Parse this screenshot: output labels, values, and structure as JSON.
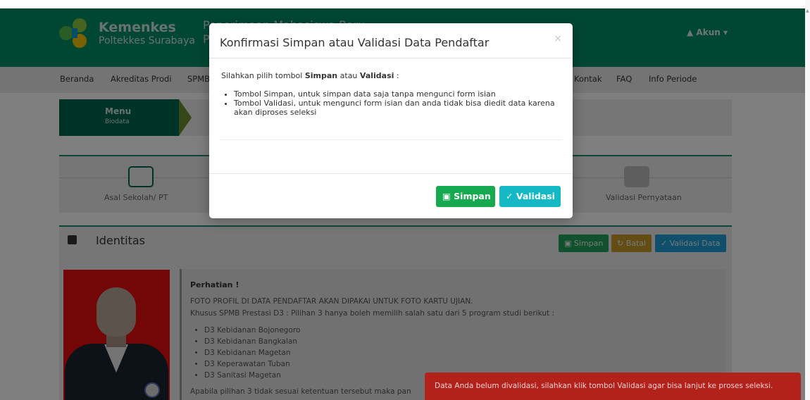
{
  "top_cut_text": "",
  "header": {
    "brand_title": "Kemenkes",
    "brand_subtitle": "Poltekkes Surabaya",
    "subtitle_line1": "Penerimaan Mahasiswa Baru",
    "subtitle_line2": "P",
    "account_label": "Akun"
  },
  "nav": [
    "Beranda",
    "Akreditas Prodi",
    "SPMB",
    "Kontak",
    "FAQ",
    "Info Periode"
  ],
  "menu": {
    "label": "Menu",
    "sublabel": "Biodata"
  },
  "steps": {
    "left_label": "Asal Sekolah/ PT",
    "right_label": "Validasi Pernyataan"
  },
  "identitas": {
    "title": "Identitas",
    "btn_simpan": "Simpan",
    "btn_batal": "Batal",
    "btn_validasi": "Validasi Data",
    "notice": {
      "title": "Perhatian !",
      "line1": "FOTO PROFIL DI DATA PENDAFTAR AKAN DIPAKAI UNTUK FOTO KARTU UJIAN.",
      "line2": "Khusus SPMB Prestasi D3 : Pilihan 3 hanya boleh memilih salah satu dari 5 program studi berikut :",
      "items": [
        "D3 Kebidanan Bojonegoro",
        "D3 Kebidanan Bangkalan",
        "D3 Kebidanan Magetan",
        "D3 Keperawatan Tuban",
        "D3 Sanitasi Magetan"
      ],
      "footer": "Apabila pilihan 3 tidak sesuai ketentuan tersebut maka pan"
    }
  },
  "modal": {
    "title": "Konfirmasi Simpan atau Validasi Data Pendaftar",
    "close": "×",
    "prompt_prefix": "Silahkan pilih tombol ",
    "prompt_simpan": "Simpan",
    "prompt_middle": " atau ",
    "prompt_validasi": "Validasi",
    "prompt_suffix": " :",
    "bullet1": "Tombol Simpan, untuk simpan data saja tanpa mengunci form isian",
    "bullet2": "Tombol Validasi, untuk mengunci form isian dan anda tidak bisa diedit data karena akan diproses seleksi",
    "btn_simpan": "Simpan",
    "btn_validasi": "Validasi"
  },
  "toast": {
    "message": "Data Anda belum divalidasi, silahkan klik tombol Validasi agar bisa lanjut ke proses seleksi."
  },
  "icons": {
    "logo": "kemenkes-logo-icon",
    "account": "user-icon",
    "save": "floppy-icon",
    "check": "check-icon",
    "refresh": "refresh-icon",
    "close": "close-icon",
    "identitas": "id-card-icon"
  },
  "colors": {
    "header": "#008f66",
    "menu_green": "#00664f",
    "btn_simpan": "#16a94f",
    "btn_validasi": "#15b9c6",
    "toast": "#b3211b"
  }
}
